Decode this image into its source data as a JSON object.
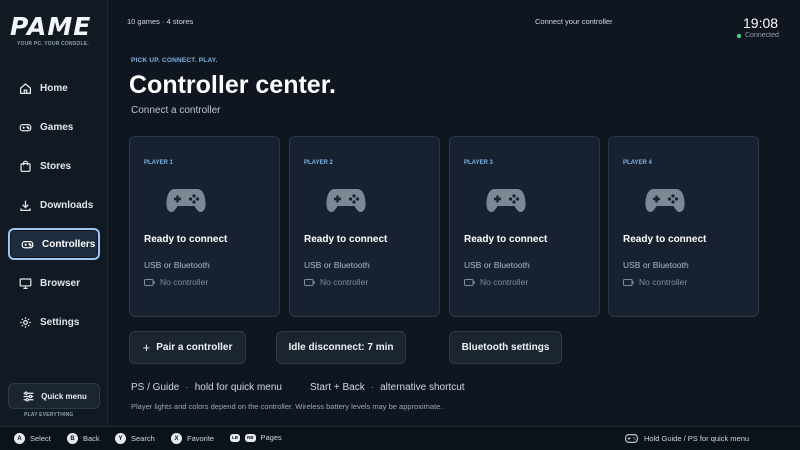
{
  "brand": {
    "logo": "PAME",
    "tagline": "YOUR PC. YOUR CONSOLE.",
    "footer_tagline": "PLAY EVERYTHING"
  },
  "topbar": {
    "library_summary": "10 games · 4 stores",
    "center_text": "Connect your controller",
    "clock": "19:08",
    "status": "Connected"
  },
  "sidebar": {
    "items": [
      {
        "label": "Home",
        "icon": "home-icon"
      },
      {
        "label": "Games",
        "icon": "gamepad-icon"
      },
      {
        "label": "Stores",
        "icon": "bag-icon"
      },
      {
        "label": "Downloads",
        "icon": "download-icon"
      },
      {
        "label": "Controllers",
        "icon": "controller-icon",
        "active": true
      },
      {
        "label": "Browser",
        "icon": "monitor-icon"
      },
      {
        "label": "Settings",
        "icon": "gear-icon"
      }
    ],
    "quick_menu_label": "Quick menu"
  },
  "page": {
    "kicker": "PICK UP. CONNECT. PLAY.",
    "title": "Controller center.",
    "subtitle": "Connect a controller"
  },
  "players": [
    {
      "slot": "PLAYER 1",
      "state": "Ready to connect",
      "connection": "USB or Bluetooth",
      "controller": "No controller"
    },
    {
      "slot": "PLAYER 2",
      "state": "Ready to connect",
      "connection": "USB or Bluetooth",
      "controller": "No controller"
    },
    {
      "slot": "PLAYER 3",
      "state": "Ready to connect",
      "connection": "USB or Bluetooth",
      "controller": "No controller"
    },
    {
      "slot": "PLAYER 4",
      "state": "Ready to connect",
      "connection": "USB or Bluetooth",
      "controller": "No controller"
    }
  ],
  "actions": {
    "pair": "Pair a controller",
    "idle": "Idle disconnect: 7 min",
    "bluetooth": "Bluetooth settings"
  },
  "hints": {
    "guide_key": "PS / Guide",
    "guide_action": "hold for quick menu",
    "alt_key": "Start + Back",
    "alt_action": "alternative shortcut",
    "note": "Player lights and colors depend on the controller. Wireless battery levels may be approximate."
  },
  "footer": {
    "select": {
      "key": "A",
      "label": "Select"
    },
    "back": {
      "key": "B",
      "label": "Back"
    },
    "search": {
      "key": "Y",
      "label": "Search"
    },
    "favorite": {
      "key": "X",
      "label": "Favorite"
    },
    "pages": {
      "keys": [
        "LB",
        "RB"
      ],
      "label": "Pages"
    },
    "right": "Hold Guide / PS for quick menu"
  },
  "colors": {
    "accent": "#7fb3e6",
    "active_border": "#9fc6ee",
    "connected": "#3ddc84",
    "background": "#0f1620"
  }
}
